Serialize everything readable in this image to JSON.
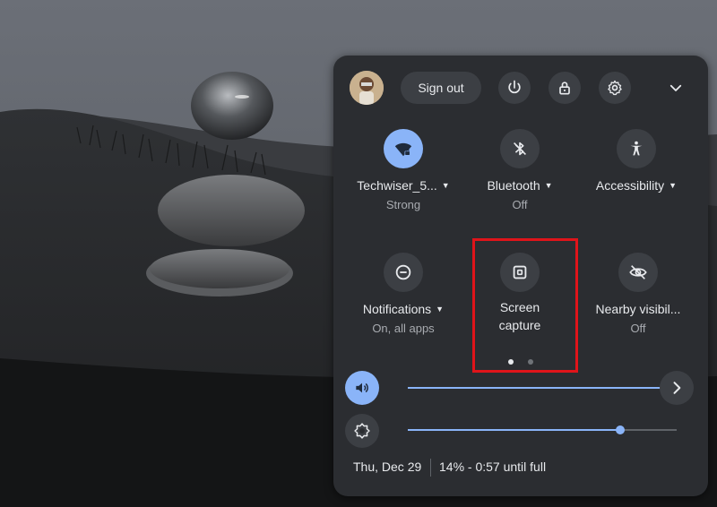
{
  "header": {
    "sign_out_label": "Sign out",
    "icons": [
      "avatar",
      "power-icon",
      "lock-icon",
      "gear-icon",
      "chevron-down-icon"
    ]
  },
  "tiles": [
    {
      "label": "Techwiser_5...",
      "sub": "Strong",
      "icon": "wifi-icon",
      "active": true,
      "caret": true
    },
    {
      "label": "Bluetooth",
      "sub": "Off",
      "icon": "bluetooth-icon",
      "active": false,
      "caret": true
    },
    {
      "label": "Accessibility",
      "sub": "",
      "icon": "accessibility-icon",
      "active": false,
      "caret": true
    },
    {
      "label": "Notifications",
      "sub": "On, all apps",
      "icon": "notifications-icon",
      "active": false,
      "caret": true
    },
    {
      "label_line1": "Screen",
      "label_line2": "capture",
      "icon": "screen-capture-icon",
      "active": false
    },
    {
      "label": "Nearby visibil...",
      "sub": "Off",
      "icon": "nearby-visibility-icon",
      "active": false
    }
  ],
  "pagination": {
    "pages": 2,
    "current": 1
  },
  "sliders": {
    "volume": {
      "icon": "volume-icon",
      "level": 0.98
    },
    "brightness": {
      "icon": "brightness-icon",
      "level": 0.79
    }
  },
  "footer": {
    "date": "Thu, Dec 29",
    "battery": "14% - 0:57 until full"
  },
  "colors": {
    "panel": "#2b2d31",
    "accent": "#8ab4f8",
    "highlight": "#e0141a"
  }
}
